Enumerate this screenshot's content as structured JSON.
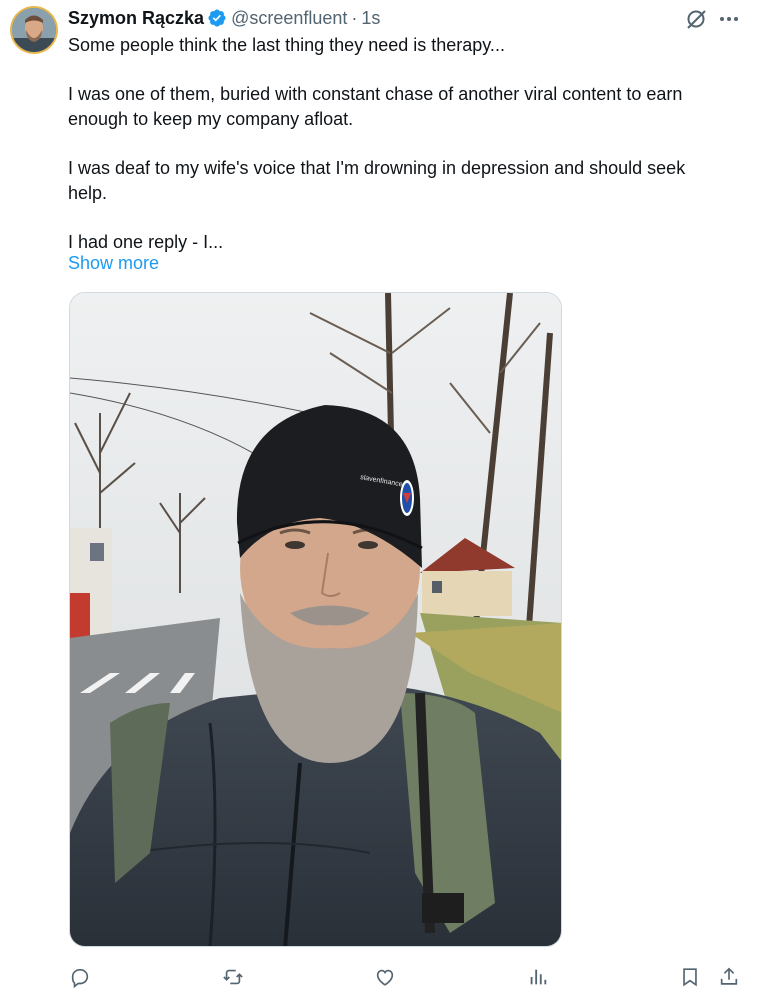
{
  "author": {
    "display_name": "Szymon Rączka",
    "handle": "@screenfluent",
    "separator": "·",
    "timestamp": "1s",
    "verified": true
  },
  "tweet": {
    "paragraphs": [
      "Some people think the last thing they need is therapy...",
      "I was one of them, buried with constant chase of another viral content to earn enough to keep my company afloat.",
      "I was deaf to my wife's voice that I'm drowning in depression and should seek help.",
      "I had one reply - I..."
    ],
    "show_more": "Show more"
  },
  "media": {
    "description_icon": "photo",
    "beanie_text": "slavenfinance"
  },
  "actions": [
    {
      "name": "reply",
      "icon": "reply-icon"
    },
    {
      "name": "repost",
      "icon": "repost-icon"
    },
    {
      "name": "like",
      "icon": "like-icon"
    },
    {
      "name": "views",
      "icon": "views-icon"
    },
    {
      "name": "bookmark",
      "icon": "bookmark-icon"
    },
    {
      "name": "share",
      "icon": "share-icon"
    }
  ],
  "colors": {
    "accent": "#1d9bf0",
    "text": "#0f1419",
    "secondary": "#536471",
    "border": "#cfd9de"
  }
}
